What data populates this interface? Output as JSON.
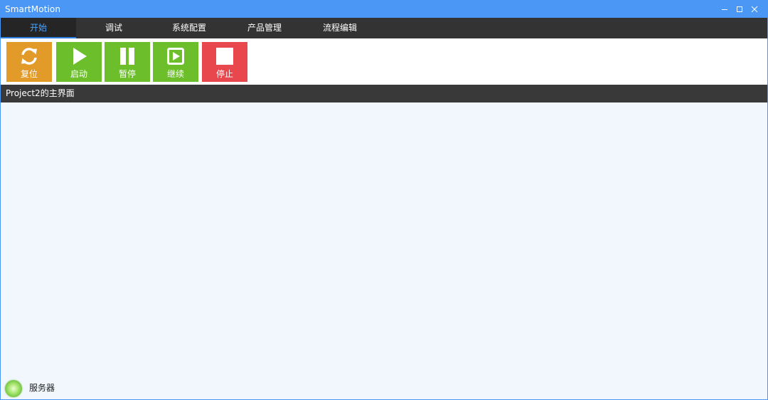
{
  "window": {
    "title": "SmartMotion"
  },
  "menu": {
    "tabs": [
      {
        "label": "开始",
        "active": true
      },
      {
        "label": "调试",
        "active": false
      },
      {
        "label": "系统配置",
        "active": false
      },
      {
        "label": "产品管理",
        "active": false
      },
      {
        "label": "流程编辑",
        "active": false
      }
    ]
  },
  "toolbar": {
    "buttons": [
      {
        "label": "复位",
        "icon": "refresh-icon",
        "color": "#e29a28"
      },
      {
        "label": "启动",
        "icon": "play-icon",
        "color": "#6cbf2a"
      },
      {
        "label": "暂停",
        "icon": "pause-icon",
        "color": "#6cbf2a"
      },
      {
        "label": "继续",
        "icon": "resume-icon",
        "color": "#6cbf2a"
      },
      {
        "label": "停止",
        "icon": "stop-icon",
        "color": "#e8484d"
      }
    ]
  },
  "main": {
    "section_title": "Project2的主界面"
  },
  "status": {
    "server_label": "服务器",
    "server_icon": "status-led-icon",
    "server_color": "#7fd04a"
  },
  "colors": {
    "titlebar": "#4a97f5",
    "menubar": "#333333",
    "active_tab_text": "#4aa3ff",
    "content_bg": "#f1f7fd"
  }
}
